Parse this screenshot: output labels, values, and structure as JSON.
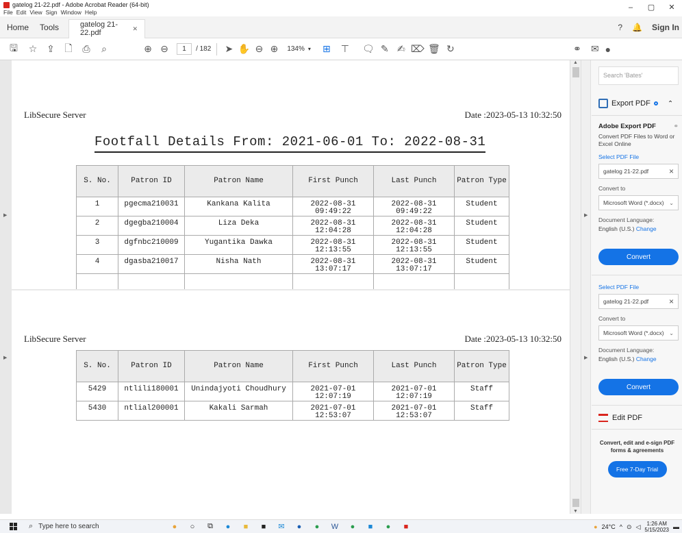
{
  "window": {
    "title": "gatelog 21-22.pdf - Adobe Acrobat Reader (64-bit)",
    "menu": [
      "File",
      "Edit",
      "View",
      "Sign",
      "Window",
      "Help"
    ]
  },
  "tabs": {
    "home": "Home",
    "tools": "Tools",
    "document": "gatelog 21-22.pdf",
    "sign_in": "Sign In"
  },
  "toolbar": {
    "page_current": "1",
    "page_total": "/ 182",
    "zoom": "134%"
  },
  "page1": {
    "server": "LibSecure Server",
    "date": "Date :2023-05-13 10:32:50",
    "title": "Footfall Details From: 2021-06-01 To: 2022-08-31",
    "headers": [
      "S. No.",
      "Patron ID",
      "Patron Name",
      "First Punch",
      "Last Punch",
      "Patron Type"
    ],
    "rows": [
      {
        "sno": "1",
        "id": "pgecma210031",
        "name": "Kankana Kalita",
        "first_date": "2022-08-31",
        "first_time": "09:49:22",
        "last_date": "2022-08-31",
        "last_time": "09:49:22",
        "type": "Student"
      },
      {
        "sno": "2",
        "id": "dgegba210004",
        "name": "Liza Deka",
        "first_date": "2022-08-31",
        "first_time": "12:04:28",
        "last_date": "2022-08-31",
        "last_time": "12:04:28",
        "type": "Student"
      },
      {
        "sno": "3",
        "id": "dgfnbc210009",
        "name": "Yugantika Dawka",
        "first_date": "2022-08-31",
        "first_time": "12:13:55",
        "last_date": "2022-08-31",
        "last_time": "12:13:55",
        "type": "Student"
      },
      {
        "sno": "4",
        "id": "dgasba210017",
        "name": "Nisha Nath",
        "first_date": "2022-08-31",
        "first_time": "13:07:17",
        "last_date": "2022-08-31",
        "last_time": "13:07:17",
        "type": "Student"
      }
    ]
  },
  "page2": {
    "server": "LibSecure Server",
    "date": "Date :2023-05-13 10:32:50",
    "headers": [
      "S. No.",
      "Patron ID",
      "Patron Name",
      "First Punch",
      "Last Punch",
      "Patron Type"
    ],
    "rows": [
      {
        "sno": "5429",
        "id": "ntlili180001",
        "name": "Unindajyoti Choudhury",
        "first_date": "2021-07-01",
        "first_time": "12:07:19",
        "last_date": "2021-07-01",
        "last_time": "12:07:19",
        "type": "Staff"
      },
      {
        "sno": "5430",
        "id": "ntlial200001",
        "name": "Kakali Sarmah",
        "first_date": "2021-07-01",
        "first_time": "12:53:07",
        "last_date": "2021-07-01",
        "last_time": "12:53:07",
        "type": "Staff"
      }
    ]
  },
  "panel": {
    "search_placeholder": "Search 'Bates'",
    "export_title": "Export PDF",
    "adobe_export": "Adobe Export PDF",
    "convert_desc": "Convert PDF Files to Word or Excel Online",
    "select_file": "Select PDF File",
    "file_name": "gatelog 21-22.pdf",
    "convert_to": "Convert to",
    "format": "Microsoft Word (*.docx)",
    "doc_lang_label": "Document Language:",
    "doc_lang": "English (U.S.)",
    "change": "Change",
    "convert_btn": "Convert",
    "edit_title": "Edit PDF",
    "promo": "Convert, edit and e-sign PDF forms & agreements",
    "trial_btn": "Free 7-Day Trial"
  },
  "taskbar": {
    "search_placeholder": "Type here to search",
    "temperature": "24°C",
    "time": "1:26 AM",
    "date": "5/15/2023"
  },
  "colors": {
    "accent": "#1473e6",
    "acrobat_red": "#d9251d"
  }
}
